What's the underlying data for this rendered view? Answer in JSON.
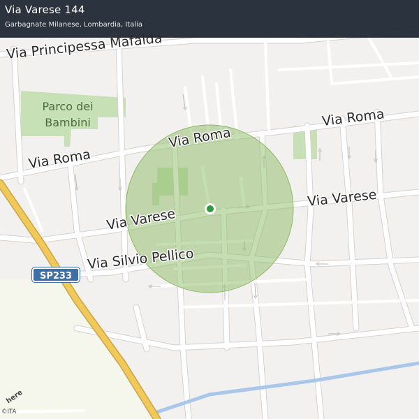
{
  "header": {
    "title": "Via Varese 144",
    "subtitle": "Garbagnate Milanese, Lombardia, Italia"
  },
  "map": {
    "street_labels": {
      "principessa_mafalda": "Via  Principessa  Mafalda",
      "roma_west": "Via  Roma",
      "roma_center": "Via  Roma",
      "roma_east": "Via  Roma",
      "varese_west": "Via  Varese",
      "varese_east": "Via  Varese",
      "silvio_pellico": "Via  Silvio  Pellico"
    },
    "park_label_line1": "Parco dei",
    "park_label_line2": "Bambini",
    "road_shield": "SP233",
    "logo_text": "here",
    "copyright": "©ITA"
  },
  "colors": {
    "background": "#f2f1ef",
    "road": "#ffffff",
    "road_casing": "#cfcfcf",
    "highway": "#e8c45a",
    "park": "#c7e0b6",
    "canal": "#a9c7ea",
    "radius_fill": "#8dbb66",
    "location_marker": "#2f9a3a",
    "header_bg": "#202834"
  },
  "marker": {
    "type": "location-dot-with-radius"
  }
}
